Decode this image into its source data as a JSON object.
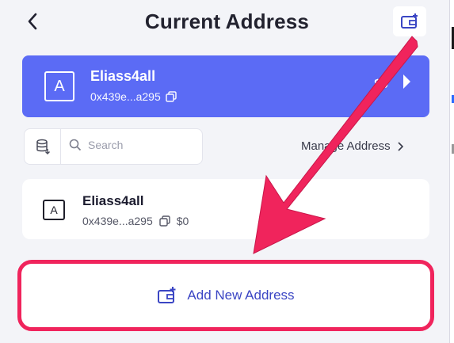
{
  "header": {
    "title": "Current Address"
  },
  "current_address": {
    "avatar_letter": "A",
    "name": "Eliass4all",
    "address": "0x439e...a295",
    "balance": "$0"
  },
  "toolbar": {
    "search_placeholder": "Search",
    "manage_label": "Manage Address"
  },
  "addresses": [
    {
      "avatar_letter": "A",
      "name": "Eliass4all",
      "address": "0x439e...a295",
      "balance": "$0"
    }
  ],
  "add_button": {
    "label": "Add New Address"
  },
  "colors": {
    "accent": "#5b6bf5",
    "highlight": "#f0245c",
    "link": "#3b46c4",
    "background": "#f3f4f8"
  },
  "icons": {
    "back": "chevron-left-icon",
    "add_address": "wallet-plus-icon",
    "copy": "copy-icon",
    "database": "database-icon",
    "search": "search-icon",
    "chevron_right": "chevron-right-icon"
  }
}
